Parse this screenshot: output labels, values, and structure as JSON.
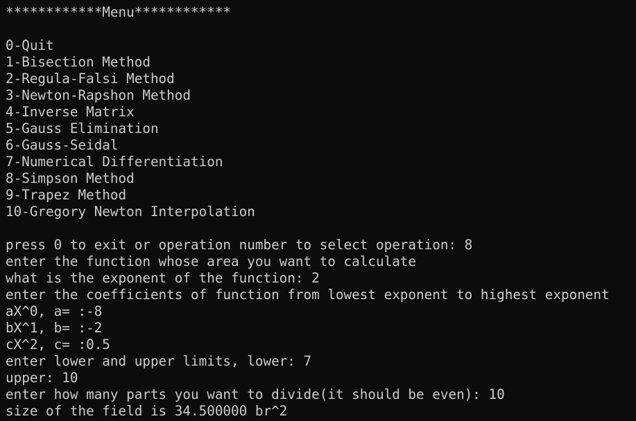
{
  "terminal": {
    "menu_header": "************Menu************",
    "menu_items": [
      "0-Quit",
      "1-Bisection Method",
      "2-Regula-Falsi Method",
      "3-Newton-Rapshon Method",
      "4-Inverse Matrix",
      "5-Gauss Elimination",
      "6-Gauss-Seidal",
      "7-Numerical Differentiation",
      "8-Simpson Method",
      "9-Trapez Method",
      "10-Gregory Newton Interpolation"
    ],
    "session": [
      "press 0 to exit or operation number to select operation: 8",
      "enter the function whose area you want to calculate",
      "what is the exponent of the function: 2",
      "enter the coefficients of function from lowest exponent to highest exponent",
      "aX^0, a= :-8",
      "bX^1, b= :-2",
      "cX^2, c= :0.5",
      "enter lower and upper limits, lower: 7",
      "upper: 10",
      "enter how many parts you want to divide(it should be even): 10",
      "size of the field is 34.500000 br^2"
    ]
  }
}
